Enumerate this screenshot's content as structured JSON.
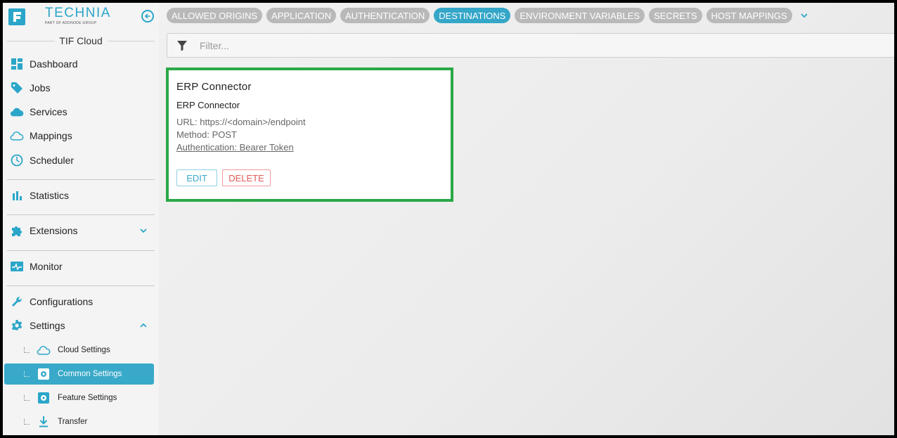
{
  "brand": {
    "name": "TECHNIA",
    "tagline": "PART OF ADDNODE GROUP",
    "logo_icon": "technia-logo-icon"
  },
  "sidebar": {
    "section_title": "TIF Cloud",
    "items": [
      {
        "label": "Dashboard",
        "icon": "dashboard-icon"
      },
      {
        "label": "Jobs",
        "icon": "tag-icon"
      },
      {
        "label": "Services",
        "icon": "cloud-filled-icon"
      },
      {
        "label": "Mappings",
        "icon": "cloud-outline-icon"
      },
      {
        "label": "Scheduler",
        "icon": "clock-icon"
      },
      {
        "label": "Statistics",
        "icon": "bar-chart-icon"
      },
      {
        "label": "Extensions",
        "icon": "puzzle-icon"
      },
      {
        "label": "Monitor",
        "icon": "monitor-icon"
      },
      {
        "label": "Configurations",
        "icon": "wrench-icon"
      },
      {
        "label": "Settings",
        "icon": "gear-icon"
      }
    ],
    "settings_children": [
      {
        "label": "Cloud Settings",
        "icon": "cloud-outline-icon"
      },
      {
        "label": "Common Settings",
        "icon": "gear-box-icon",
        "active": true
      },
      {
        "label": "Feature Settings",
        "icon": "gear-box-icon"
      },
      {
        "label": "Transfer",
        "icon": "download-icon"
      }
    ]
  },
  "tabs": [
    {
      "label": "ALLOWED ORIGINS"
    },
    {
      "label": "APPLICATION"
    },
    {
      "label": "AUTHENTICATION"
    },
    {
      "label": "DESTINATIONS",
      "active": true
    },
    {
      "label": "ENVIRONMENT VARIABLES"
    },
    {
      "label": "SECRETS"
    },
    {
      "label": "HOST MAPPINGS"
    }
  ],
  "filter": {
    "placeholder": "Filter...",
    "value": ""
  },
  "card": {
    "title": "ERP Connector",
    "subtitle": "ERP Connector",
    "url": "URL: https://<domain>/endpoint",
    "method": "Method: POST",
    "authentication": "Authentication: Bearer Token",
    "edit_label": "EDIT",
    "delete_label": "DELETE"
  },
  "colors": {
    "accent": "#34a6c8",
    "tab_inactive": "#b9b9b9",
    "card_border": "#2aa846",
    "delete": "#e05a5a"
  }
}
